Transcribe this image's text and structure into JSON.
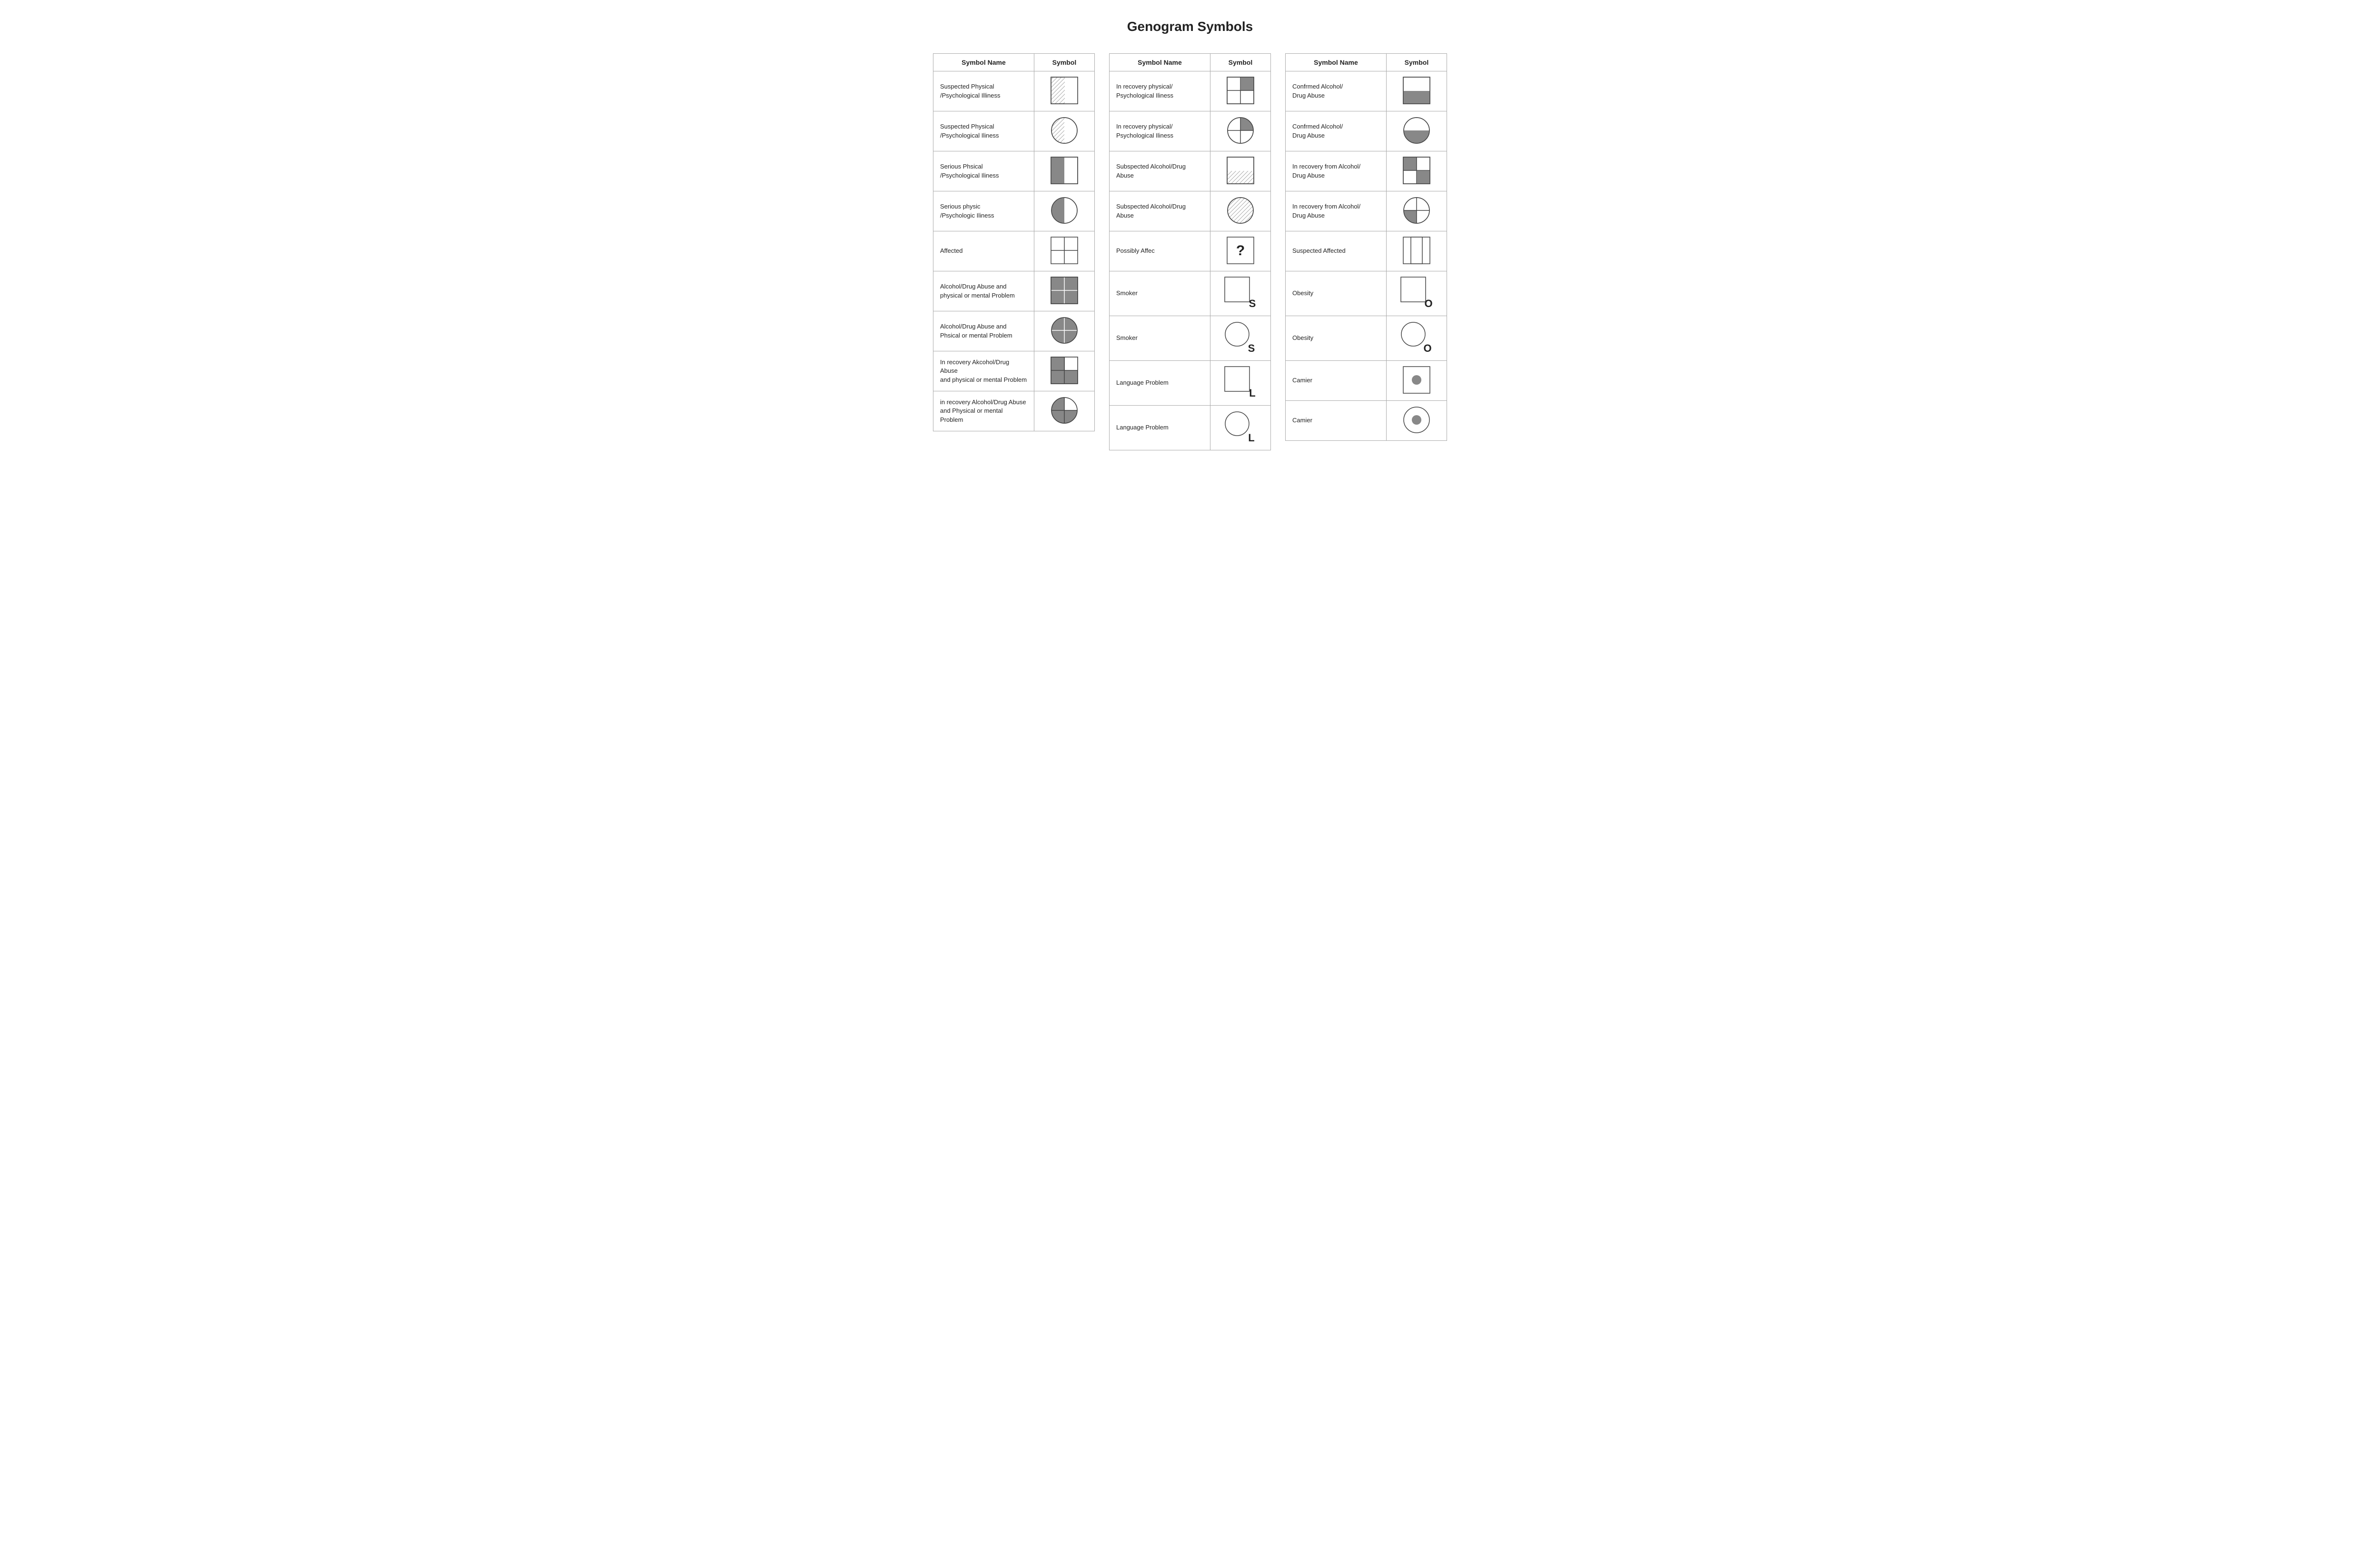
{
  "page": {
    "title": "Genogram Symbols",
    "tables": [
      {
        "id": "table1",
        "headers": [
          "Symbol Name",
          "Symbol"
        ],
        "rows": [
          {
            "name": "Suspected Physical\n/Psychological Illiness",
            "symbol": "rect-hatch-right"
          },
          {
            "name": "Suspected Physical\n/Psychological Iliness",
            "symbol": "circle-hatch-left"
          },
          {
            "name": "Serious Phsical\n/Psychological Iliness",
            "symbol": "rect-grey-left"
          },
          {
            "name": "Serious physic\n/Psychologic Iliness",
            "symbol": "circle-grey-left"
          },
          {
            "name": "Affected",
            "symbol": "rect-four-squares"
          },
          {
            "name": "Alcohol/Drug Abuse and\nphysical or mental Problem",
            "symbol": "rect-four-squares-grey"
          },
          {
            "name": "Alcohol/Drug Abuse and\nPhsical or mental Problem",
            "symbol": "circle-four-grey"
          },
          {
            "name": "In recovery Akcohol/Drug Abuse\nand physical or mental Problem",
            "symbol": "rect-four-dark"
          },
          {
            "name": "in recovery Alcohol/Drug Abuse\nand Physical or mental Problem",
            "symbol": "circle-four-dark"
          }
        ]
      },
      {
        "id": "table2",
        "headers": [
          "Symbol Name",
          "Symbol"
        ],
        "rows": [
          {
            "name": "In recovery physical/\nPsychological Iliness",
            "symbol": "rect-top-grey"
          },
          {
            "name": "In recovery physical/\nPsychological Iliness",
            "symbol": "circle-top-grey"
          },
          {
            "name": "Subspected Alcohol/Drug\nAbuse",
            "symbol": "rect-bottom-hatch"
          },
          {
            "name": "Subspected Alcohol/Drug\nAbuse",
            "symbol": "circle-hatch-all"
          },
          {
            "name": "Possibly Affec",
            "symbol": "rect-question"
          },
          {
            "name": "Smoker",
            "symbol": "rect-S"
          },
          {
            "name": "Smoker",
            "symbol": "circle-S"
          },
          {
            "name": "Language Problem",
            "symbol": "rect-L"
          },
          {
            "name": "Language Problem",
            "symbol": "circle-L"
          }
        ]
      },
      {
        "id": "table3",
        "headers": [
          "Symbol Name",
          "Symbol"
        ],
        "rows": [
          {
            "name": "Confrmed Alcohol/\nDrug Abuse",
            "symbol": "rect-bottom-grey"
          },
          {
            "name": "Confrmed Alcohol/\nDrug Abuse",
            "symbol": "circle-bottom-grey"
          },
          {
            "name": "In recovery from Alcohol/\nDrug Abuse",
            "symbol": "rect-four-mixed"
          },
          {
            "name": "In recovery from Alcohol/\nDrug Abuse",
            "symbol": "circle-quarter-grey"
          },
          {
            "name": "Suspected Affected",
            "symbol": "rect-inner-small"
          },
          {
            "name": "Obesity",
            "symbol": "rect-O"
          },
          {
            "name": "Obesity",
            "symbol": "circle-O"
          },
          {
            "name": "Camier",
            "symbol": "circle-dot-rect"
          },
          {
            "name": "Camier",
            "symbol": "circle-dot-circle"
          }
        ]
      }
    ]
  }
}
